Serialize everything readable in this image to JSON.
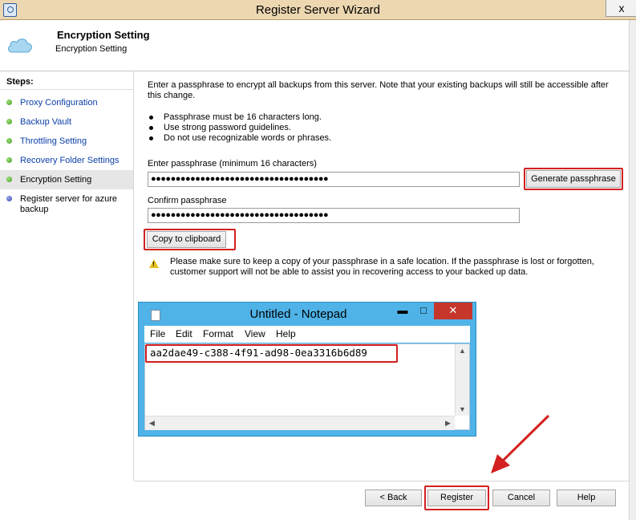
{
  "window": {
    "title": "Register Server Wizard",
    "close_glyph": "x"
  },
  "header": {
    "title": "Encryption Setting",
    "subtitle": "Encryption Setting",
    "icon": "cloud-icon"
  },
  "steps": {
    "heading": "Steps:",
    "items": [
      {
        "label": "Proxy Configuration",
        "status": "complete"
      },
      {
        "label": "Backup Vault",
        "status": "complete"
      },
      {
        "label": "Throttling Setting",
        "status": "complete"
      },
      {
        "label": "Recovery Folder Settings",
        "status": "complete"
      },
      {
        "label": "Encryption Setting",
        "status": "current"
      },
      {
        "label": "Register server for azure backup",
        "status": "pending"
      }
    ]
  },
  "main": {
    "intro": "Enter a passphrase to encrypt all backups from this server. Note that your existing backups will still be accessible after this change.",
    "bullets": [
      "Passphrase must be 16 characters long.",
      "Use strong password guidelines.",
      "Do not use recognizable words or phrases."
    ],
    "passphrase_label": "Enter passphrase (minimum 16 characters)",
    "passphrase_value": "●●●●●●●●●●●●●●●●●●●●●●●●●●●●●●●●●●●●",
    "generate_button": "Generate passphrase",
    "confirm_label": "Confirm passphrase",
    "confirm_value": "●●●●●●●●●●●●●●●●●●●●●●●●●●●●●●●●●●●●",
    "copy_button": "Copy to clipboard",
    "warning": "Please make sure to keep a copy of your passphrase in a safe location. If the passphrase is lost or forgotten, customer support will not be able to assist you in recovering access to your backed up data."
  },
  "notepad": {
    "title": "Untitled - Notepad",
    "menu": [
      "File",
      "Edit",
      "Format",
      "View",
      "Help"
    ],
    "content": "aa2dae49-c388-4f91-ad98-0ea3316b6d89",
    "minimize_glyph": "▬",
    "maximize_glyph": "□",
    "close_glyph": "✕"
  },
  "footer": {
    "back": "< Back",
    "register": "Register",
    "cancel": "Cancel",
    "help": "Help"
  },
  "colors": {
    "highlight": "#d32020",
    "titlebar": "#ecd7b1",
    "notepad_frame": "#4fb3e8",
    "link": "#0b3fa8"
  }
}
